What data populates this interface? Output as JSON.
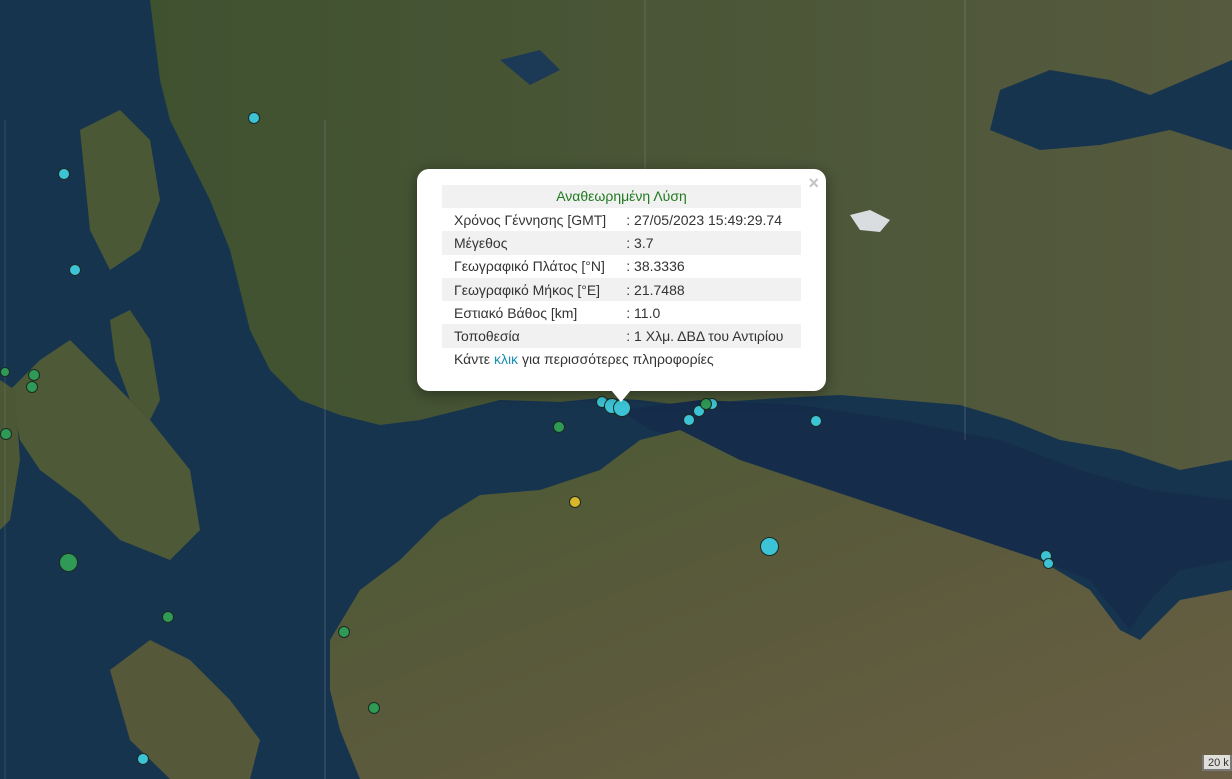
{
  "map": {
    "base": "satellite",
    "sea_color": "#17344f",
    "land_color": "#4c5a32"
  },
  "popup": {
    "title": "Αναθεωρημένη Λύση",
    "close_label": "×",
    "rows": [
      {
        "label": "Χρόνος Γέννησης [GMT]",
        "value": ": 27/05/2023 15:49:29.74"
      },
      {
        "label": "Μέγεθος",
        "value": ": 3.7"
      },
      {
        "label": "Γεωγραφικό Πλάτος [°N]",
        "value": ": 38.3336"
      },
      {
        "label": "Γεωγραφικό Μήκος [°E]",
        "value": ": 21.7488"
      },
      {
        "label": "Εστιακό Βάθος [km]",
        "value": ": 11.0"
      },
      {
        "label": "Τοποθεσία",
        "value": ": 1 Χλμ. ΔΒΔ του Αντιρίου"
      }
    ],
    "more_prefix": "Κάντε",
    "more_link": "κλικ",
    "more_suffix": "για περισσότερες πληροφορίες"
  },
  "scale_label": "20 k",
  "colors": {
    "cyan_marker": "#3cc4d6",
    "green_marker": "#2e9a55",
    "yellow_marker": "#d9b52a",
    "popup_title": "#1f7a1f",
    "link": "#1a8fb3"
  }
}
